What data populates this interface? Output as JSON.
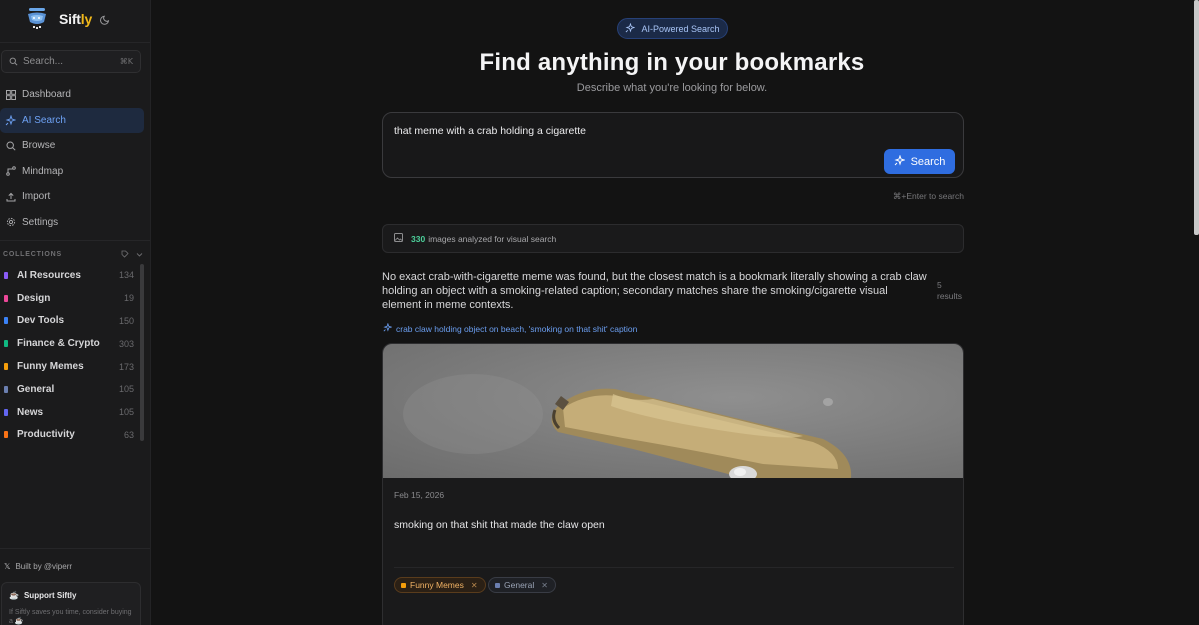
{
  "app": {
    "name_main": "Sift",
    "name_accent": "ly",
    "accent_color": "#f0b81a"
  },
  "sidebar": {
    "search": {
      "placeholder": "Search...",
      "shortcut": "⌘K"
    },
    "nav": [
      {
        "label": "Dashboard",
        "icon": "dashboard-icon",
        "active": false
      },
      {
        "label": "AI Search",
        "icon": "sparkle-icon",
        "active": true
      },
      {
        "label": "Browse",
        "icon": "search-icon",
        "active": false
      },
      {
        "label": "Mindmap",
        "icon": "mindmap-icon",
        "active": false
      },
      {
        "label": "Import",
        "icon": "upload-icon",
        "active": false
      },
      {
        "label": "Settings",
        "icon": "gear-icon",
        "active": false
      }
    ],
    "collections_heading": "COLLECTIONS",
    "collections": [
      {
        "name": "AI Resources",
        "count": "134",
        "color": "#8b5cf6"
      },
      {
        "name": "Design",
        "count": "19",
        "color": "#ec4899"
      },
      {
        "name": "Dev Tools",
        "count": "150",
        "color": "#3b82f6"
      },
      {
        "name": "Finance & Crypto",
        "count": "303",
        "color": "#10b981"
      },
      {
        "name": "Funny Memes",
        "count": "173",
        "color": "#f59e0b"
      },
      {
        "name": "General",
        "count": "105",
        "color": "#6b7fb0"
      },
      {
        "name": "News",
        "count": "105",
        "color": "#6366f1"
      },
      {
        "name": "Productivity",
        "count": "63",
        "color": "#f97316"
      }
    ],
    "built_by": "Built by @viperr",
    "support": {
      "title": "Support Siftly",
      "desc": "If Siftly saves you time, consider buying a ☕"
    }
  },
  "main": {
    "pill_label": "AI-Powered Search",
    "headline": "Find anything in your bookmarks",
    "subline": "Describe what you're looking for below.",
    "query_value": "that meme with a crab holding a cigarette",
    "search_button": "Search",
    "hint": "⌘+Enter to search",
    "stats": {
      "count": "330",
      "text": "images analyzed for visual search"
    },
    "answer": "No exact crab-with-cigarette meme was found, but the closest match is a bookmark literally showing a crab claw holding an object with a smoking-related caption; secondary matches share the smoking/cigarette visual element in meme contexts.",
    "results_count": "5",
    "results_label": "results",
    "match_tags": "crab claw holding object on beach, 'smoking on that shit' caption",
    "card": {
      "date": "Feb 15, 2026",
      "title": "smoking on that shit that made the claw open",
      "chips": [
        {
          "label": "Funny Memes",
          "color": "#f59e0b"
        },
        {
          "label": "General",
          "color": "#6b7fb0"
        }
      ]
    }
  }
}
